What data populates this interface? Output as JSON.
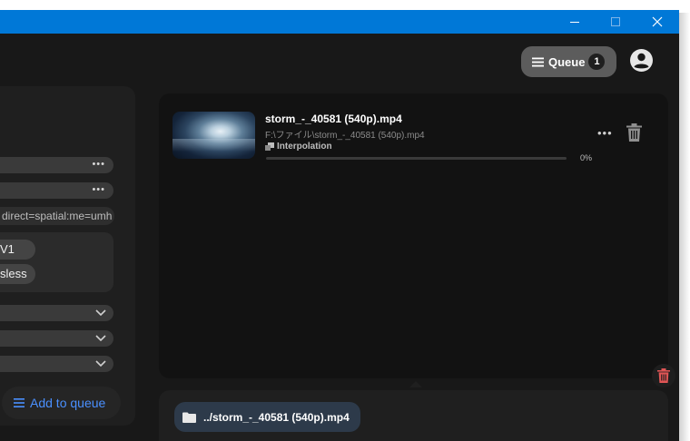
{
  "window": {
    "titlebar_color": "#0078d7",
    "controls": [
      "minimize-icon",
      "maximize-icon",
      "close-icon"
    ]
  },
  "header": {
    "queue_label": "Queue",
    "queue_count": "1",
    "account_icon": "account-circle-icon"
  },
  "settings_panel": {
    "option_1_menu": "•••",
    "option_2_menu": "•••",
    "filter_text": "direct=spatial:me=umh -",
    "codec_tag": "V1",
    "quality_tag": "sless",
    "selects": [
      "",
      "",
      ""
    ],
    "add_to_queue": "Add to queue",
    "accent": "#4a90ff"
  },
  "queue": {
    "item": {
      "filename": "storm_-_40581 (540p).mp4",
      "path": "F:\\ファイル\\storm_-_40581 (540p).mp4",
      "task": "Interpolation",
      "progress_text": "0%",
      "progress": 0,
      "more_menu": "•••"
    },
    "clear_icon_color": "#e05555"
  },
  "output": {
    "path": "../storm_-_40581 (540p).mp4"
  }
}
